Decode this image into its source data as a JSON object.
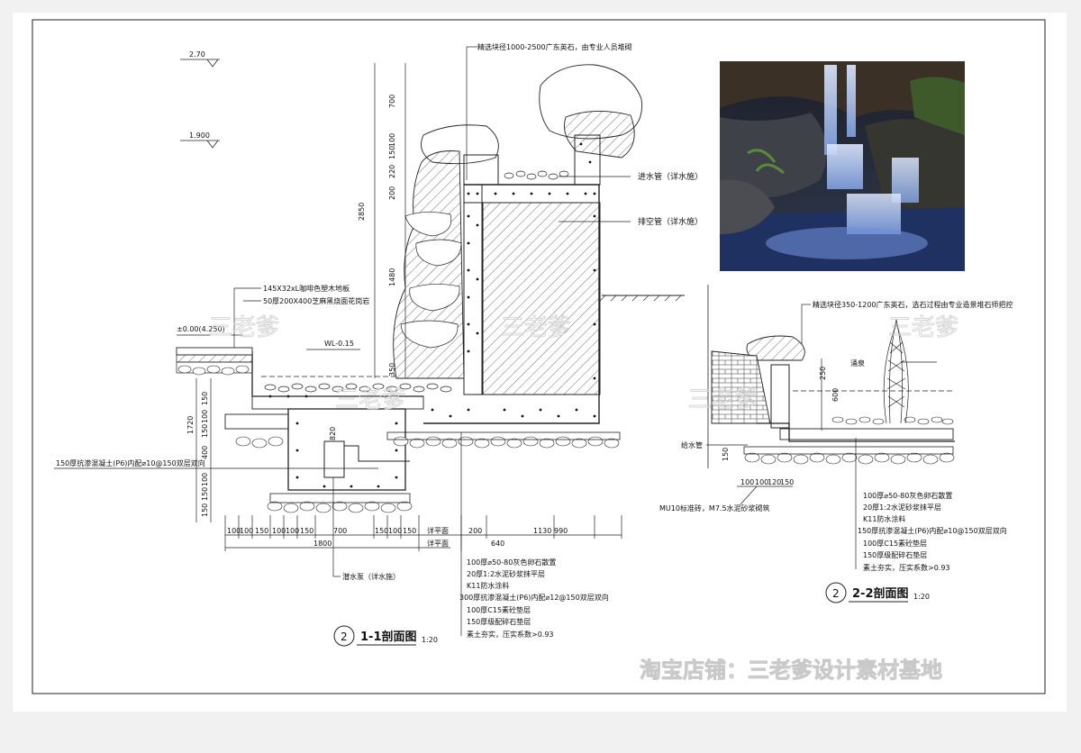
{
  "elevations": {
    "top": "2.70",
    "mid": "1.900",
    "ground": "±0.00(4.250)",
    "water_level": "WL-0.15"
  },
  "section_1_1": {
    "title_number": "2",
    "title": "1-1剖面图",
    "scale": "1:20",
    "stone_note": "精选块径1000-2500广东英石，由专业人员堆砌",
    "inlet_pipe": "进水管（详水施）",
    "drain_pipe": "排空管（详水施）",
    "deck_note_1": "145X32xL咖啡色塑木地板",
    "deck_note_2": "50厚200X400芝麻黑烧面花岗岩",
    "slab_note": "150厚抗渗混凝土(P6)内配⌀10@150双层双向",
    "pump": "潜水泵（详水施）",
    "pump_dim": "820",
    "dims_vertical_right": [
      "700",
      "100",
      "150",
      "220",
      "200",
      "1480",
      "2850"
    ],
    "dim_wl": "350",
    "dims_vertical_left": [
      "150",
      "100",
      "150",
      "1720",
      "400",
      "100",
      "150",
      "150"
    ],
    "dims_bottom": [
      "100",
      "100",
      "150",
      "100",
      "100",
      "150",
      "700",
      "150",
      "100",
      "150",
      "200",
      "1130",
      "990"
    ],
    "dims_total": [
      "1800",
      "640"
    ],
    "level_labels": [
      "详平面",
      "详平面"
    ],
    "layers": [
      "100厚⌀50-80灰色卵石散置",
      "20厚1:2水泥砂浆抹平层",
      "K11防水涂料",
      "300厚抗渗混凝土(P6)内配⌀12@150双层双向",
      "100厚C15素砼垫层",
      "150厚级配碎石垫层",
      "素土夯实，压实系数>0.93"
    ]
  },
  "section_2_2": {
    "title_number": "2",
    "title": "2-2剖面图",
    "scale": "1:20",
    "stone_note": "精选块径350-1200广东英石，选石过程由专业造景堆石师把控",
    "fountain": "涌泉",
    "supply_pipe": "给水管",
    "wall_note": "MU10标准砖，M7.5水泥砂浆砌筑",
    "dims_vertical": [
      "250",
      "600",
      "150"
    ],
    "dims_bottom": [
      "100",
      "100",
      "120",
      "150"
    ],
    "dim_left": "150",
    "layers": [
      "100厚⌀50-80灰色卵石散置",
      "20厚1:2水泥砂浆抹平层",
      "K11防水涂料",
      "150厚抗渗混凝土(P6)内配⌀10@150双层双向",
      "100厚C15素砼垫层",
      "150厚级配碎石垫层",
      "素土夯实，压实系数>0.93"
    ]
  },
  "watermarks": {
    "ghost": "三老爹",
    "shop": "淘宝店铺：三老爹设计素材基地"
  }
}
